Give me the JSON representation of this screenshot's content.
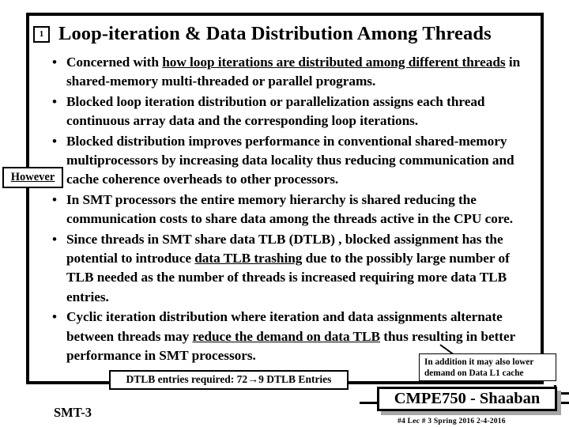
{
  "slide": {
    "number": "1",
    "title": "Loop-iteration & Data Distribution Among Threads",
    "caption": "SMT-3",
    "bullet_marker": "•"
  },
  "bullets": [
    {
      "segments": [
        {
          "text": "Concerned with ",
          "underline": false
        },
        {
          "text": "how loop iterations are distributed among different threads",
          "underline": true
        },
        {
          "text": " in shared-memory multi-threaded or parallel programs.",
          "underline": false
        }
      ]
    },
    {
      "segments": [
        {
          "text": "Blocked loop iteration distribution or parallelization assigns each thread continuous array data and the corresponding loop iterations.",
          "underline": false
        }
      ]
    },
    {
      "segments": [
        {
          "text": "Blocked distribution improves performance in conventional shared-memory multiprocessors by  increasing data locality thus reducing communication and cache coherence overheads to other processors.",
          "underline": false
        }
      ]
    },
    {
      "segments": [
        {
          "text": "In SMT processors the entire memory hierarchy  is shared reducing the communication costs to share data among the threads active in the CPU core.",
          "underline": false
        }
      ]
    },
    {
      "segments": [
        {
          "text": "Since threads in SMT share data TLB (DTLB) , blocked assignment has the potential to introduce ",
          "underline": false
        },
        {
          "text": "data TLB trashing",
          "underline": true
        },
        {
          "text": " due to the possibly large number of TLB needed as the number of threads is increased requiring more data TLB entries.",
          "underline": false
        }
      ]
    },
    {
      "segments": [
        {
          "text": "Cyclic iteration distribution where iteration and data assignments alternate between threads may ",
          "underline": false
        },
        {
          "text": "reduce the demand on data TLB",
          "underline": true
        },
        {
          "text": " thus resulting in better performance in SMT processors.",
          "underline": false
        }
      ]
    }
  ],
  "callouts": {
    "however": "However",
    "dtlb_entries": {
      "prefix": "DTLB entries required:  72",
      "arrow": "→",
      "suffix": "9  DTLB Entries"
    },
    "addition": {
      "line1": "In addition it may also lower",
      "line2": "demand on Data L1 cache"
    }
  },
  "footer": {
    "title": "CMPE750 - Shaaban",
    "meta": "#4   Lec # 3   Spring 2016  2-4-2016"
  },
  "colors": {
    "ink": "#000000",
    "paper": "#ffffff",
    "shadow": "#a6a6a6"
  }
}
